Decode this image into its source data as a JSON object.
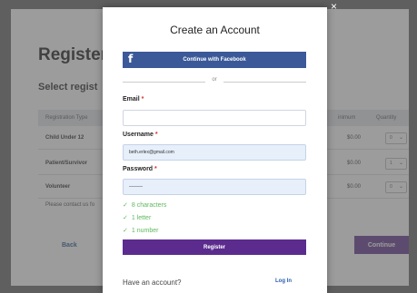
{
  "background": {
    "title": "Register",
    "subtitle": "Select regist",
    "table_headers": {
      "type": "Registration Type",
      "minimum": "inimum",
      "quantity": "Quantity"
    },
    "rows": [
      {
        "type": "Child Under 12",
        "price": "$0.00",
        "qty": "0"
      },
      {
        "type": "Patient/Survivor",
        "price": "$0.00",
        "qty": "1"
      },
      {
        "type": "Volunteer",
        "price": "$0.00",
        "qty": "0"
      }
    ],
    "contact_text": "Please contact us fo",
    "back_label": "Back",
    "continue_label": "Continue",
    "close_glyph": "×"
  },
  "modal": {
    "title": "Create an Account",
    "facebook_label": "Continue with Facebook",
    "facebook_icon_glyph": "f",
    "or_text": "or",
    "email_label": "Email",
    "email_value": "",
    "username_label": "Username",
    "username_value": "beth.erlex@gmail.com",
    "password_label": "Password",
    "password_value": "———",
    "required_mark": "*",
    "rules": [
      "8 characters",
      "1 letter",
      "1 number"
    ],
    "check_glyph": "✓",
    "register_label": "Register",
    "have_account_text": "Have an account?",
    "login_label": "Log In"
  },
  "colors": {
    "facebook": "#3b5998",
    "primary": "#5b2c8e",
    "success": "#5fb85f",
    "required": "#d32f2f",
    "link": "#2a5db0"
  }
}
